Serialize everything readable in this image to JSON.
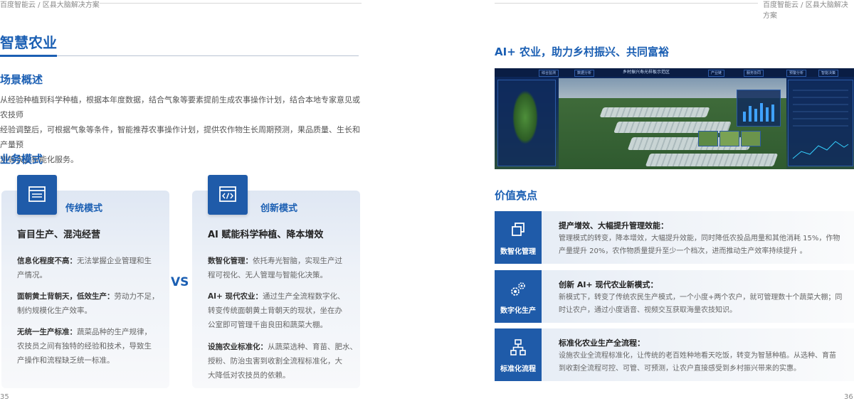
{
  "header": {
    "left_text": "百度智能云 / 区县大脑解决方案",
    "right_text": "百度智能云 / 区县大脑解决方案"
  },
  "pages": {
    "left": "35",
    "right": "36"
  },
  "left": {
    "title": "智慧农业",
    "scene_title": "场景概述",
    "scene_lines": [
      "从经验种植到科学种植，根据本年度数据，结合气象等要素提前生成农事操作计划，结合本地专家意见或农技师",
      "经验调整后，可根据气象等条件，智能推荐农事操作计划，提供农作物生长周期预测，果品质量、生长和产量预",
      "测等农业智能化服务。"
    ],
    "business_title": "业务模式",
    "vs": "VS",
    "cards": [
      {
        "mode": "传统模式",
        "heading": "盲目生产、混沌经营",
        "items": [
          {
            "label": "信息化程度不高：",
            "lines": [
              "无法掌握企业管理和生",
              "产情况。"
            ]
          },
          {
            "label": "面朝黄土背朝天，低效生产：",
            "lines": [
              "劳动力不足，",
              "制约规模化生产效率。"
            ]
          },
          {
            "label": "无统一生产标准：",
            "lines": [
              "蔬菜品种的生产规律，",
              "农技员之间有独特的经验和技术，导致生",
              "产操作和流程缺乏统一标准。"
            ]
          }
        ]
      },
      {
        "mode": "创新模式",
        "heading": "AI 赋能科学种植、降本增效",
        "items": [
          {
            "label": "数智化管理：",
            "lines": [
              "依托寿光智脑，实现生产过",
              "程可视化、无人管理与智能化决策。"
            ]
          },
          {
            "label": "AI+ 现代农业：",
            "lines": [
              "通过生产全流程数字化、",
              "转变传统面朝黄土背朝天的现状，坐在办",
              "公室即可管理千亩良田和蔬菜大棚。"
            ]
          },
          {
            "label": "设施农业标准化：",
            "lines": [
              "从蔬菜选种、育苗、肥水、",
              "授粉、防治虫害到收割全流程标准化，大",
              "大降低对农技员的依赖。"
            ]
          }
        ]
      }
    ]
  },
  "right": {
    "title": "AI+ 农业，助力乡村振兴、共同富裕",
    "dashboard": {
      "title": "乡村振兴寿光样板示范区",
      "tabs": [
        "综合监测",
        "数据分析",
        "产业链",
        "服务协同",
        "预警分析",
        "智能决策"
      ]
    },
    "value_title": "价值亮点",
    "values": [
      {
        "icon": "layers-icon",
        "label": "数智化管理",
        "title": "提产增效、大幅提升管理效能：",
        "lines": [
          "管理模式的转变，降本增效，大幅提升效能，同时降低农投品用量和其他消耗 15%，作物",
          "产量提升 20%，农作物质量提升至少一个档次，进而推动生产效率持续提升 。"
        ]
      },
      {
        "icon": "gears-icon",
        "label": "数字化生产",
        "title": "创新 AI+ 现代农业新模式：",
        "lines": [
          "新模式下，转变了传统农民生产模式，一个小度+两个农户，就可管理数十个蔬菜大棚；同",
          "时让农户，通过小度语音、视频交互获取海量农技知识。"
        ]
      },
      {
        "icon": "hierarchy-icon",
        "label": "标准化流程",
        "title": "标准化农业生产全流程：",
        "lines": [
          "设施农业全流程标准化，让传统的老百姓种地看天吃饭，转变为智慧种植。从选种、育苗",
          "到收割全流程可控、可管、可预测，让农户直接感受到乡村振兴带来的实惠。"
        ]
      }
    ]
  },
  "colors": {
    "accent": "#1b5fb3",
    "icon_bg": "#1f5ba9"
  }
}
